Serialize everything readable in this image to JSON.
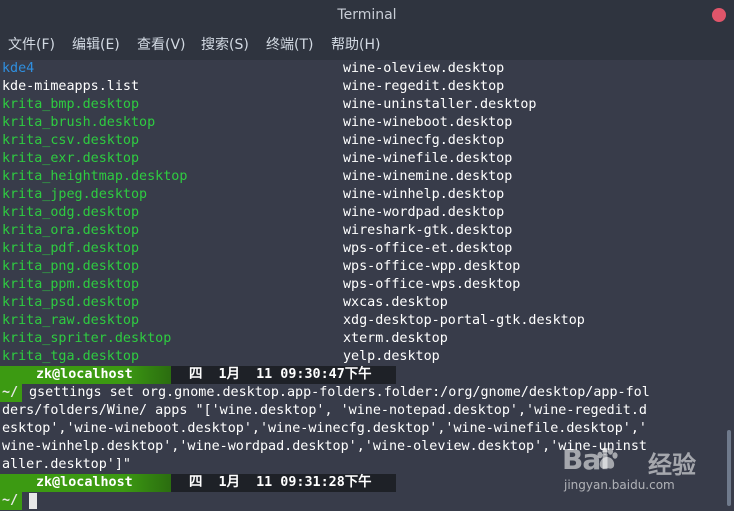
{
  "window": {
    "title": "Terminal"
  },
  "menu": [
    "文件(F)",
    "编辑(E)",
    "查看(V)",
    "搜索(S)",
    "终端(T)",
    "帮助(H)"
  ],
  "listing": [
    {
      "left": "kde4",
      "left_color": "blue",
      "right": "wine-oleview.desktop"
    },
    {
      "left": "kde-mimeapps.list",
      "left_color": "white",
      "right": "wine-regedit.desktop"
    },
    {
      "left": "krita_bmp.desktop",
      "left_color": "green",
      "right": "wine-uninstaller.desktop"
    },
    {
      "left": "krita_brush.desktop",
      "left_color": "green",
      "right": "wine-wineboot.desktop"
    },
    {
      "left": "krita_csv.desktop",
      "left_color": "green",
      "right": "wine-winecfg.desktop"
    },
    {
      "left": "krita_exr.desktop",
      "left_color": "green",
      "right": "wine-winefile.desktop"
    },
    {
      "left": "krita_heightmap.desktop",
      "left_color": "green",
      "right": "wine-winemine.desktop"
    },
    {
      "left": "krita_jpeg.desktop",
      "left_color": "green",
      "right": "wine-winhelp.desktop"
    },
    {
      "left": "krita_odg.desktop",
      "left_color": "green",
      "right": "wine-wordpad.desktop"
    },
    {
      "left": "krita_ora.desktop",
      "left_color": "green",
      "right": "wireshark-gtk.desktop"
    },
    {
      "left": "krita_pdf.desktop",
      "left_color": "green",
      "right": "wps-office-et.desktop"
    },
    {
      "left": "krita_png.desktop",
      "left_color": "green",
      "right": "wps-office-wpp.desktop"
    },
    {
      "left": "krita_ppm.desktop",
      "left_color": "green",
      "right": "wps-office-wps.desktop"
    },
    {
      "left": "krita_psd.desktop",
      "left_color": "green",
      "right": "wxcas.desktop"
    },
    {
      "left": "krita_raw.desktop",
      "left_color": "green",
      "right": "xdg-desktop-portal-gtk.desktop"
    },
    {
      "left": "krita_spriter.desktop",
      "left_color": "green",
      "right": "xterm.desktop"
    },
    {
      "left": "krita_tga.desktop",
      "left_color": "green",
      "right": "yelp.desktop"
    }
  ],
  "prompt1": {
    "host": "zk@localhost",
    "time": "四  1月  11 09:30:47下午"
  },
  "command": {
    "tilde": "~/",
    "lines": [
      "gsettings set org.gnome.desktop.app-folders.folder:/org/gnome/desktop/app-fol",
      "ders/folders/Wine/ apps \"['wine.desktop', 'wine-notepad.desktop','wine-regedit.d",
      "esktop','wine-wineboot.desktop','wine-winecfg.desktop','wine-winefile.desktop','",
      "wine-winhelp.desktop','wine-wordpad.desktop','wine-oleview.desktop','wine-uninst",
      "aller.desktop']\""
    ]
  },
  "prompt2": {
    "host": "zk@localhost",
    "time": "四  1月  11 09:31:28下午"
  },
  "prompt_current": {
    "tilde": "~/"
  },
  "watermark": {
    "logo": "Bai  ",
    "cn": "经验",
    "url": "jingyan.baidu.com"
  },
  "colors": {
    "blue": "#2f8fe0",
    "green": "#2ecc40",
    "prompt_green": "#3c9a12",
    "close": "#e0556a"
  }
}
